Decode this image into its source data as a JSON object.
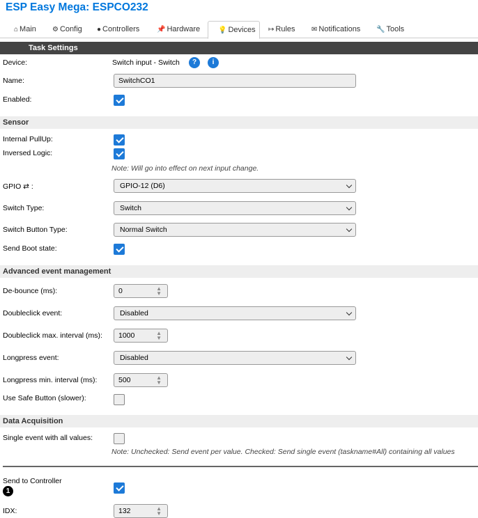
{
  "app_title": "ESP Easy Mega: ESPCO232",
  "tabs": [
    {
      "label": "Main",
      "icon": "⌂"
    },
    {
      "label": "Config",
      "icon": "⚙"
    },
    {
      "label": "Controllers",
      "icon": "●"
    },
    {
      "label": "Hardware",
      "icon": "📌"
    },
    {
      "label": "Devices",
      "icon": "💡"
    },
    {
      "label": "Rules",
      "icon": "↦"
    },
    {
      "label": "Notifications",
      "icon": "✉"
    },
    {
      "label": "Tools",
      "icon": "🔧"
    }
  ],
  "task_settings": {
    "header": "Task Settings",
    "device_label": "Device:",
    "device_value": "Switch input - Switch",
    "help_icon": "?",
    "info_icon": "i",
    "name_label": "Name:",
    "name_value": "SwitchCO1",
    "enabled_label": "Enabled:",
    "enabled": true
  },
  "sensor": {
    "header": "Sensor",
    "pullup_label": "Internal PullUp:",
    "pullup": true,
    "inversed_label": "Inversed Logic:",
    "inversed": true,
    "inversed_note": "Note: Will go into effect on next input change.",
    "gpio_label": "GPIO ⇄ :",
    "gpio_value": "GPIO-12 (D6)",
    "switch_type_label": "Switch Type:",
    "switch_type_value": "Switch",
    "button_type_label": "Switch Button Type:",
    "button_type_value": "Normal Switch",
    "boot_state_label": "Send Boot state:",
    "boot_state": true
  },
  "advanced": {
    "header": "Advanced event management",
    "debounce_label": "De-bounce (ms):",
    "debounce_value": "0",
    "doubleclick_label": "Doubleclick event:",
    "doubleclick_value": "Disabled",
    "dc_interval_label": "Doubleclick max. interval (ms):",
    "dc_interval_value": "1000",
    "longpress_label": "Longpress event:",
    "longpress_value": "Disabled",
    "lp_interval_label": "Longpress min. interval (ms):",
    "lp_interval_value": "500",
    "safe_button_label": "Use Safe Button (slower):",
    "safe_button": false
  },
  "data_acquisition": {
    "header": "Data Acquisition",
    "single_event_label": "Single event with all values:",
    "single_event": false,
    "single_event_note": "Note: Unchecked: Send event per value. Checked: Send single event (taskname#All) containing all values"
  },
  "controller": {
    "send_label": "Send to Controller",
    "badge": "1",
    "send": true,
    "idx_label": "IDX:",
    "idx_value": "132"
  }
}
